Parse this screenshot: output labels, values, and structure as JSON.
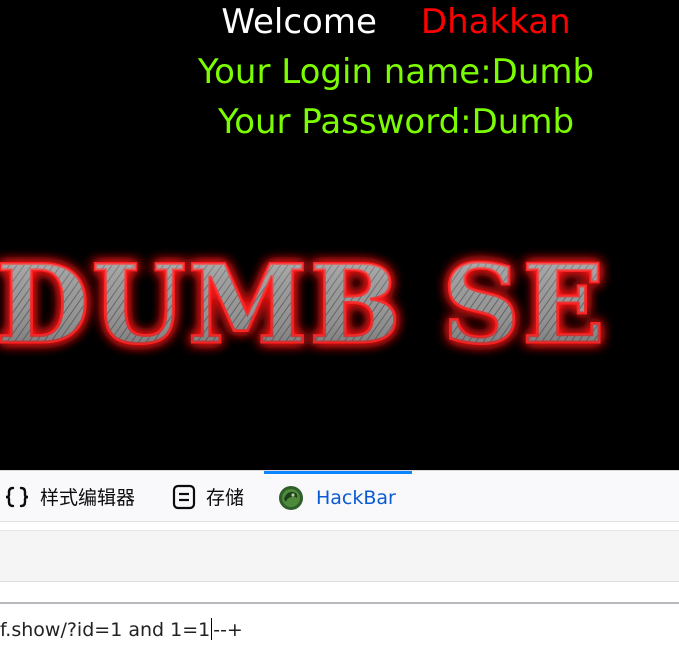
{
  "page": {
    "welcome_label": "Welcome",
    "user_name": "Dhakkan",
    "login_line": "Your Login name:Dumb",
    "password_line": "Your Password:Dumb",
    "banner_text": "DUMB SE"
  },
  "devtools": {
    "tabs": [
      {
        "label": "样式编辑器",
        "icon": "braces-icon"
      },
      {
        "label": "存储",
        "icon": "storage-icon"
      },
      {
        "label": "HackBar",
        "icon": "hackbar-icon",
        "active": true
      }
    ],
    "url_before_caret": "f.show/?id=1 and 1=1",
    "url_after_caret": "--+"
  },
  "colors": {
    "background": "#000000",
    "welcome": "#ffffff",
    "user_name": "#ff0000",
    "info": "#7cfc00",
    "active_tab": "#0a84ff"
  }
}
